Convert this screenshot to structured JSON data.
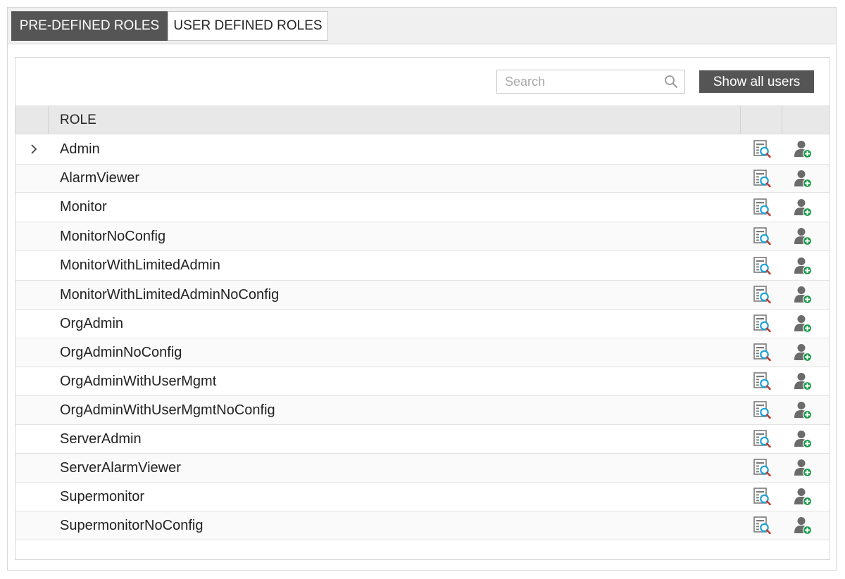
{
  "tabs": [
    {
      "label": "PRE-DEFINED ROLES",
      "active": true
    },
    {
      "label": "USER DEFINED ROLES",
      "active": false
    }
  ],
  "toolbar": {
    "search_placeholder": "Search",
    "search_value": "",
    "show_all_label": "Show all users"
  },
  "table": {
    "header_role": "ROLE",
    "rows": [
      {
        "name": "Admin",
        "expandable": true
      },
      {
        "name": "AlarmViewer"
      },
      {
        "name": "Monitor"
      },
      {
        "name": "MonitorNoConfig"
      },
      {
        "name": "MonitorWithLimitedAdmin"
      },
      {
        "name": "MonitorWithLimitedAdminNoConfig"
      },
      {
        "name": "OrgAdmin"
      },
      {
        "name": "OrgAdminNoConfig"
      },
      {
        "name": "OrgAdminWithUserMgmt"
      },
      {
        "name": "OrgAdminWithUserMgmtNoConfig"
      },
      {
        "name": "ServerAdmin"
      },
      {
        "name": "ServerAlarmViewer"
      },
      {
        "name": "Supermonitor"
      },
      {
        "name": "SupermonitorNoConfig"
      }
    ]
  },
  "icons": {
    "view": "view-details-icon",
    "add_user": "add-user-icon",
    "search": "search-icon",
    "expand": "chevron-right-icon"
  },
  "colors": {
    "active_tab": "#555555",
    "button": "#555555",
    "magnifier": "#1aa3d9",
    "add_badge": "#1a9a4a"
  }
}
